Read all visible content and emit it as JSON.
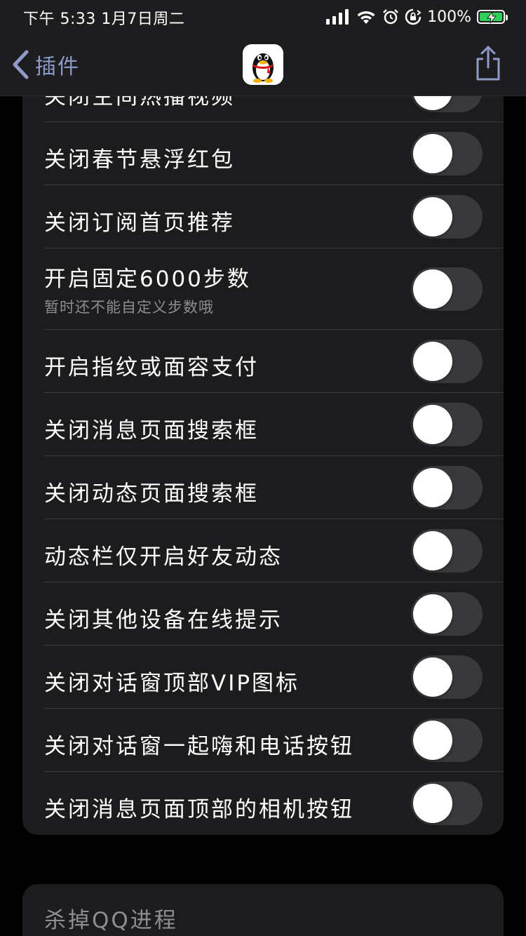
{
  "status_bar": {
    "time_date": "下午 5:33   1月7日周二",
    "battery_percent": "100%",
    "battery_level": 1.0,
    "icons": [
      "signal-icon",
      "wifi-icon",
      "alarm-icon",
      "orientation-lock-icon",
      "battery-icon"
    ]
  },
  "nav": {
    "back_label": "插件",
    "app_icon": "qq-penguin-icon",
    "share_icon": "share-icon"
  },
  "colors": {
    "accent": "#8e9ac9",
    "background": "#000000",
    "group_background": "#1c1c1e",
    "toggle_off": "#39393d",
    "battery_green": "#30d158"
  },
  "settings": [
    {
      "label": "关闭空间热播视频",
      "on": false
    },
    {
      "label": "关闭春节悬浮红包",
      "on": false
    },
    {
      "label": "关闭订阅首页推荐",
      "on": false
    },
    {
      "label": "开启固定6000步数",
      "sub": "暂时还不能自定义步数哦",
      "on": false
    },
    {
      "label": "开启指纹或面容支付",
      "on": false
    },
    {
      "label": "关闭消息页面搜索框",
      "on": false
    },
    {
      "label": "关闭动态页面搜索框",
      "on": false
    },
    {
      "label": "动态栏仅开启好友动态",
      "on": false
    },
    {
      "label": "关闭其他设备在线提示",
      "on": false
    },
    {
      "label": "关闭对话窗顶部VIP图标",
      "on": false
    },
    {
      "label": "关闭对话窗一起嗨和电话按钮",
      "on": false
    },
    {
      "label": "关闭消息页面顶部的相机按钮",
      "on": false
    }
  ],
  "actions": {
    "kill_qq_label": "杀掉QQ进程"
  }
}
